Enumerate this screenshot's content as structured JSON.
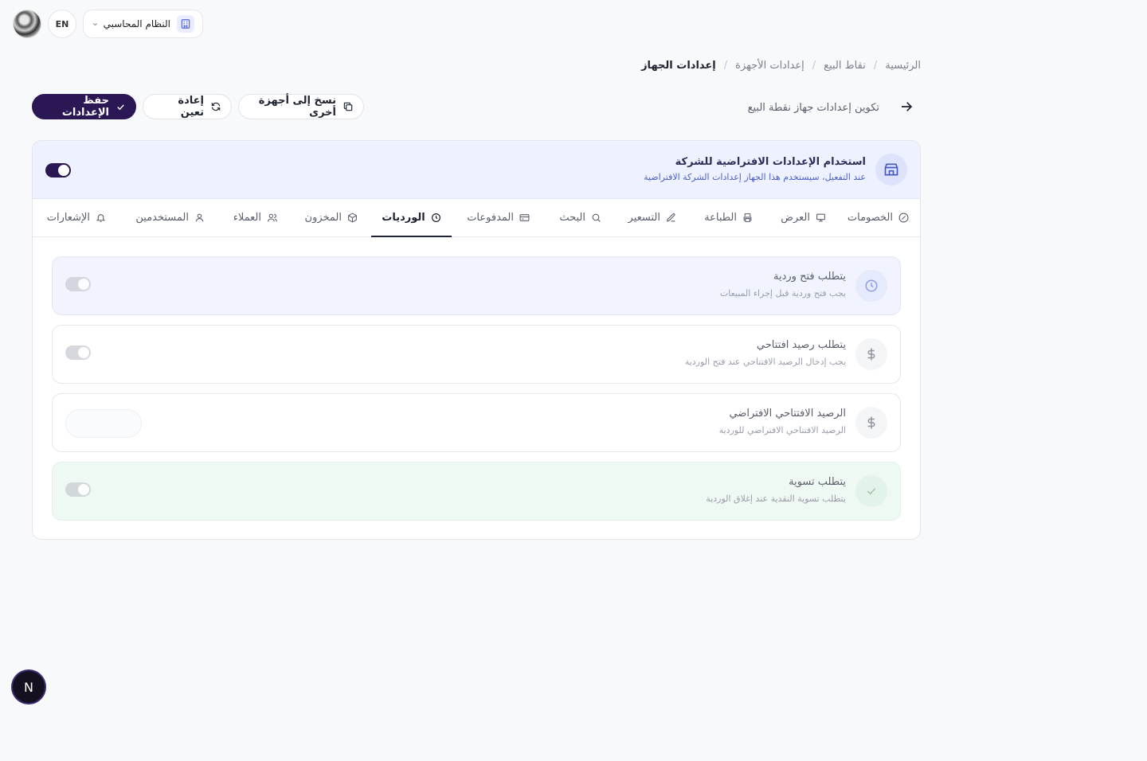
{
  "topbar": {
    "lang": "EN",
    "company_label": "النظام المحاسبي"
  },
  "breadcrumb": {
    "items": [
      "الرئيسية",
      "نقاط البيع",
      "إعدادات الأجهزة"
    ],
    "current": "إعدادات الجهاز"
  },
  "header": {
    "subtitle": "تكوين إعدادات جهاز نقطة البيع",
    "copy_label": "نسخ إلى أجهزة أخرى",
    "reset_label": "إعادة تعين",
    "save_label": "حفظ الإعدادات"
  },
  "default_banner": {
    "title": "استخدام الإعدادات الافتراضية للشركة",
    "description": "عند التفعيل، سيستخدم هذا الجهاز إعدادات الشركة الافتراضية",
    "enabled": true
  },
  "tabs": [
    {
      "label": "الخصومات",
      "icon": "percent-icon"
    },
    {
      "label": "العرض",
      "icon": "monitor-icon"
    },
    {
      "label": "الطباعة",
      "icon": "printer-icon"
    },
    {
      "label": "التسعير",
      "icon": "edit-icon"
    },
    {
      "label": "البحث",
      "icon": "search-icon"
    },
    {
      "label": "المدفوعات",
      "icon": "credit-card-icon"
    },
    {
      "label": "الورديات",
      "icon": "clock-icon",
      "active": true
    },
    {
      "label": "المخزون",
      "icon": "package-icon"
    },
    {
      "label": "العملاء",
      "icon": "users-icon"
    },
    {
      "label": "المستخدمين",
      "icon": "user-icon"
    },
    {
      "label": "الإشعارات",
      "icon": "bell-icon"
    }
  ],
  "settings": [
    {
      "title": "يتطلب فتح وردية",
      "description": "يجب فتح وردية قبل إجراء المبيعات",
      "icon": "clock-icon",
      "control": "toggle",
      "enabled": false
    },
    {
      "title": "يتطلب رصيد افتتاحي",
      "description": "يجب إدخال الرصيد الافتتاحي عند فتح الوردية",
      "icon": "dollar-icon",
      "control": "toggle",
      "enabled": false
    },
    {
      "title": "الرصيد الافتتاحي الافتراضي",
      "description": "الرصيد الافتتاحي الافتراضي للوردية",
      "icon": "dollar-icon",
      "control": "input",
      "value": ""
    },
    {
      "title": "يتطلب تسوية",
      "description": "يتطلب تسوية النقدية عند إغلاق الوردية",
      "icon": "check-icon",
      "control": "toggle",
      "enabled": false
    }
  ],
  "fab_label": "N"
}
